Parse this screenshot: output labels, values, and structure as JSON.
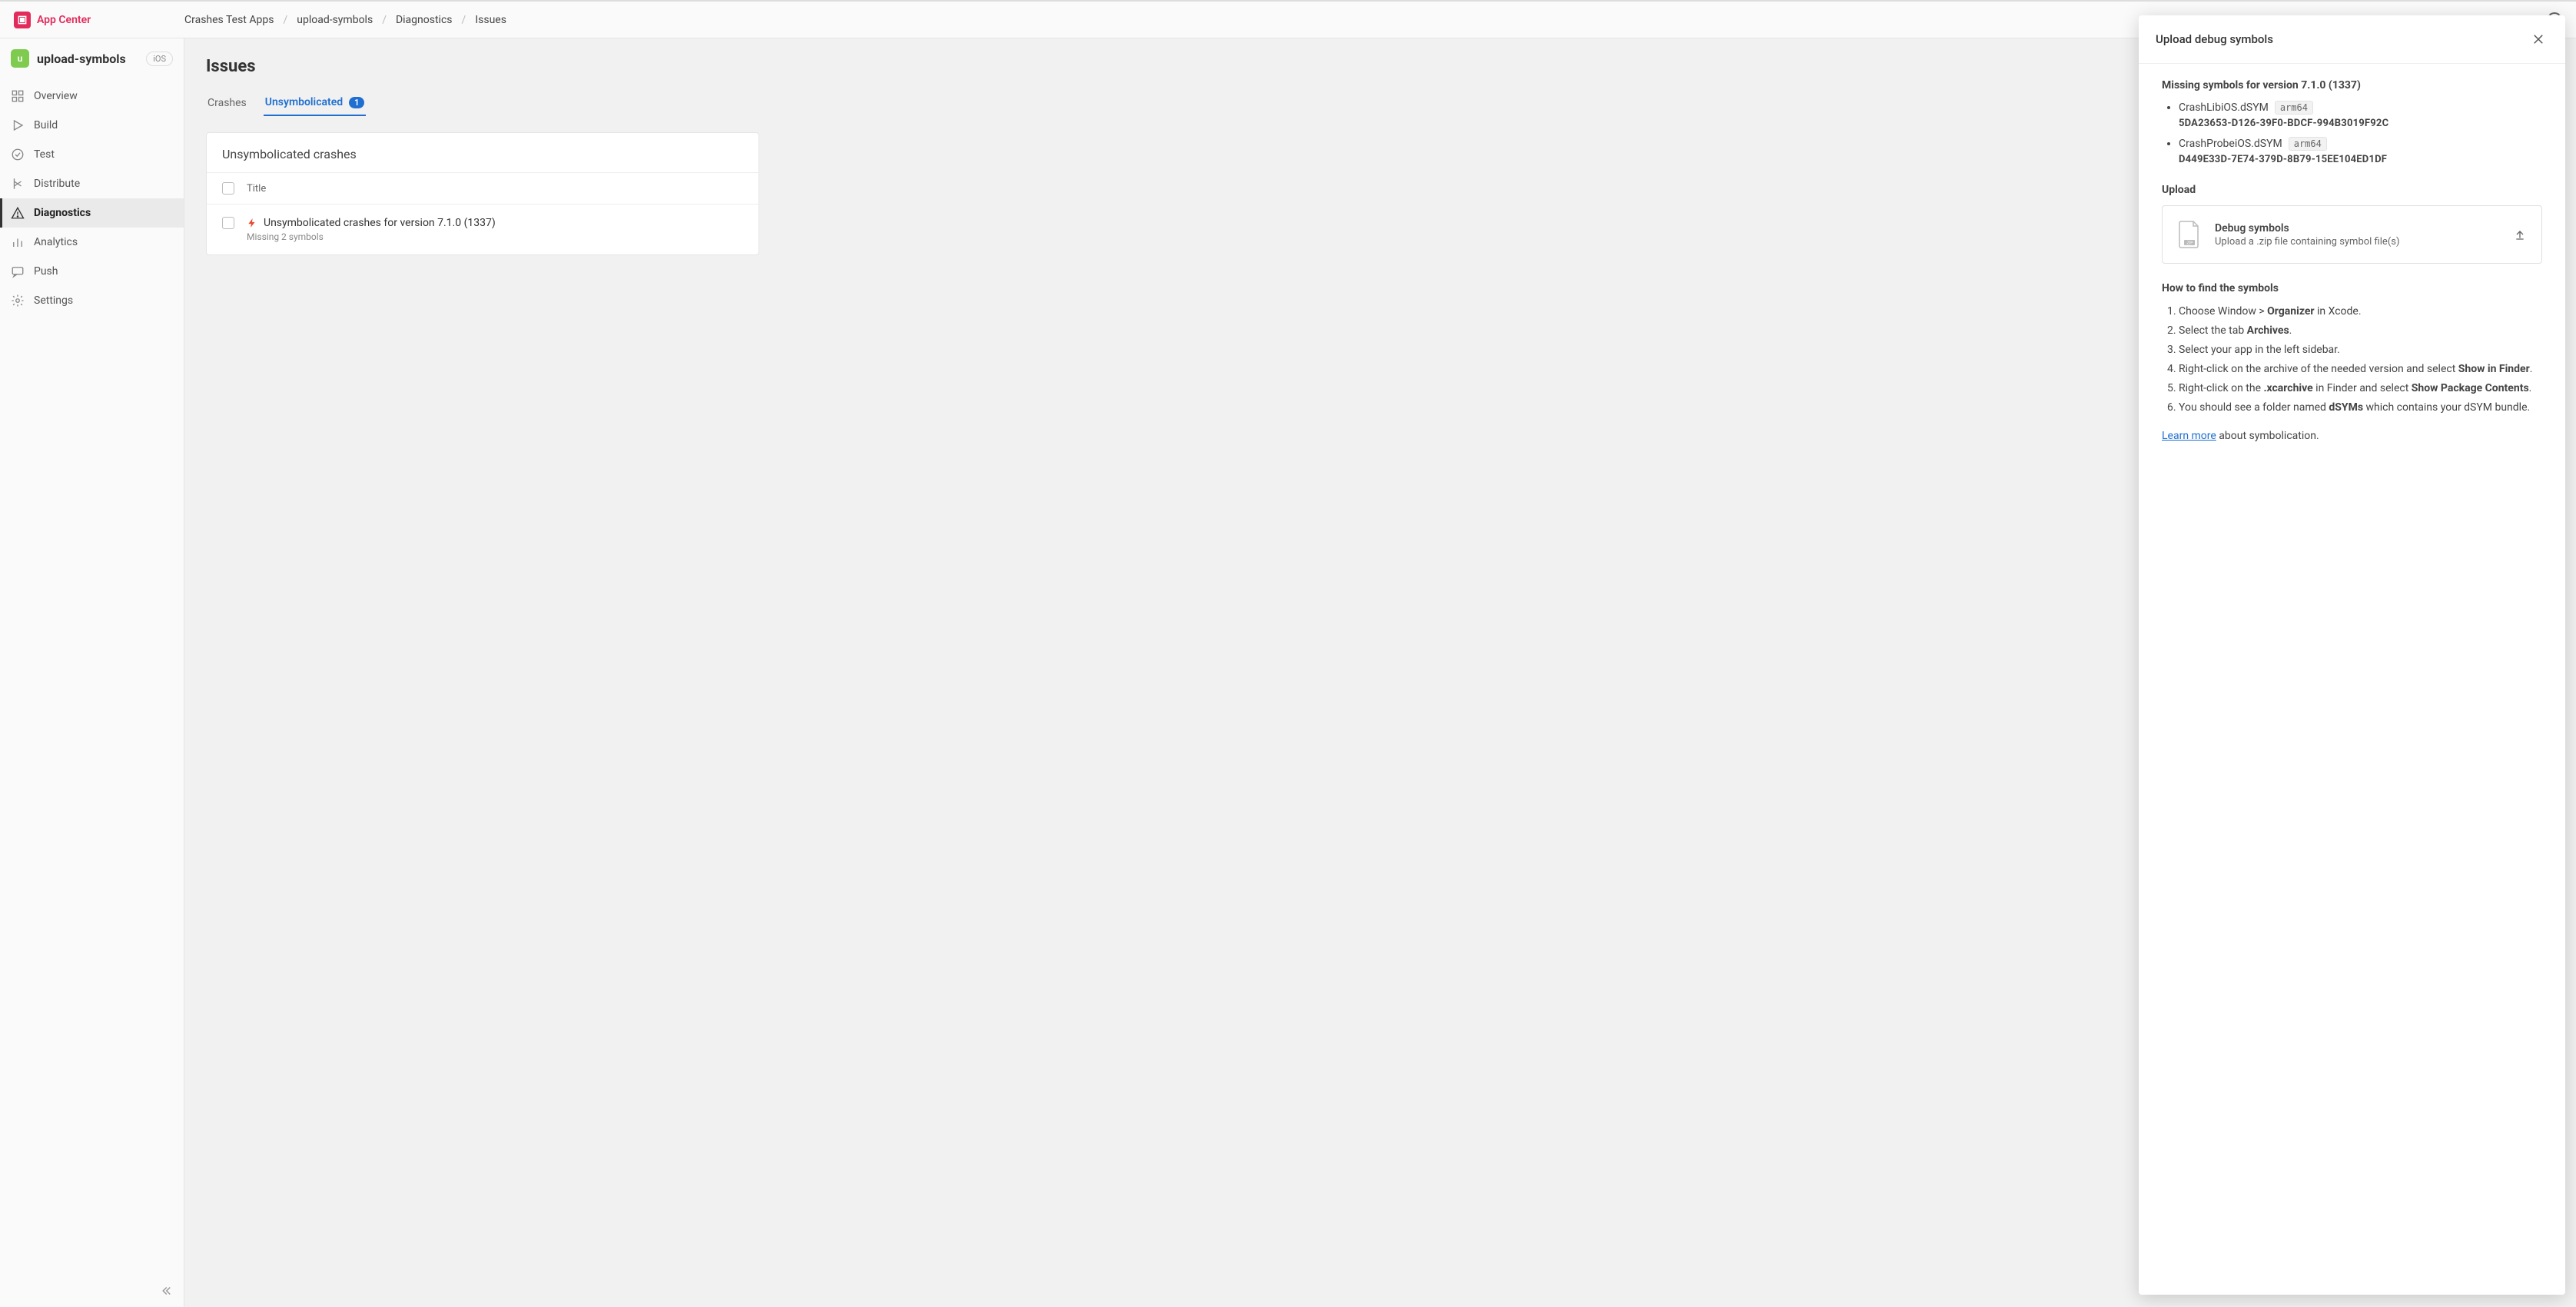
{
  "brand": "App Center",
  "breadcrumbs": [
    "Crashes Test Apps",
    "upload-symbols",
    "Diagnostics",
    "Issues"
  ],
  "app": {
    "badge_letter": "u",
    "name": "upload-symbols",
    "platform": "iOS"
  },
  "nav": {
    "overview": "Overview",
    "build": "Build",
    "test": "Test",
    "distribute": "Distribute",
    "diagnostics": "Diagnostics",
    "analytics": "Analytics",
    "push": "Push",
    "settings": "Settings"
  },
  "page": {
    "title": "Issues",
    "tabs": {
      "crashes": "Crashes",
      "unsymbolicated": "Unsymbolicated",
      "unsymbolicated_count": "1"
    },
    "panel_title": "Unsymbolicated crashes",
    "table_header_title": "Title",
    "row": {
      "title": "Unsymbolicated crashes for version 7.1.0 (1337)",
      "subtitle": "Missing 2 symbols"
    }
  },
  "sheet": {
    "title": "Upload debug symbols",
    "missing_heading": "Missing symbols for version 7.1.0 (1337)",
    "symbols": [
      {
        "name": "CrashLibiOS.dSYM",
        "arch": "arm64",
        "uuid": "5DA23653-D126-39F0-BDCF-994B3019F92C"
      },
      {
        "name": "CrashProbeiOS.dSYM",
        "arch": "arm64",
        "uuid": "D449E33D-7E74-379D-8B79-15EE104ED1DF"
      }
    ],
    "upload_heading": "Upload",
    "dropzone": {
      "title": "Debug symbols",
      "subtitle": "Upload a .zip file containing symbol file(s)"
    },
    "howto_heading": "How to find the symbols",
    "instructions": {
      "i1_a": "Choose Window > ",
      "i1_b": "Organizer",
      "i1_c": " in Xcode.",
      "i2_a": "Select the tab ",
      "i2_b": "Archives",
      "i2_c": ".",
      "i3": "Select your app in the left sidebar.",
      "i4_a": "Right-click on the archive of the needed version and select ",
      "i4_b": "Show in Finder",
      "i4_c": ".",
      "i5_a": "Right-click on the ",
      "i5_b": ".xcarchive",
      "i5_c": " in Finder and select ",
      "i5_d": "Show Package Contents",
      "i5_e": ".",
      "i6_a": "You should see a folder named ",
      "i6_b": "dSYMs",
      "i6_c": " which contains your dSYM bundle."
    },
    "learn_more": "Learn more",
    "learn_more_suffix": " about symbolication."
  }
}
